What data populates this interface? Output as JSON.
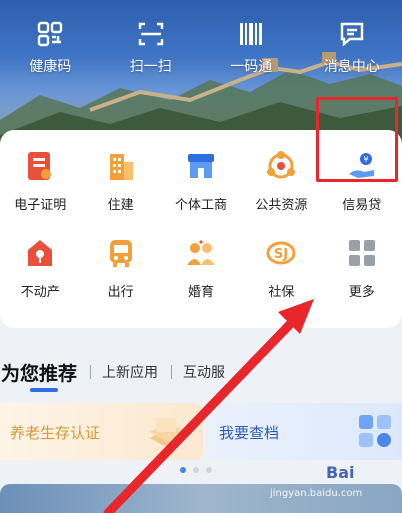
{
  "quick_actions": [
    {
      "label": "健康码",
      "icon": "health-code-icon"
    },
    {
      "label": "扫一扫",
      "icon": "scan-icon"
    },
    {
      "label": "一码通",
      "icon": "barcode-icon"
    },
    {
      "label": "消息中心",
      "icon": "message-icon"
    }
  ],
  "services_row1": [
    {
      "label": "电子证明",
      "icon": "certificate-icon"
    },
    {
      "label": "住建",
      "icon": "building-icon"
    },
    {
      "label": "个体工商",
      "icon": "shop-icon"
    },
    {
      "label": "公共资源",
      "icon": "resource-icon"
    },
    {
      "label": "信易贷",
      "icon": "loan-icon"
    }
  ],
  "services_row2": [
    {
      "label": "不动产",
      "icon": "house-key-icon"
    },
    {
      "label": "出行",
      "icon": "bus-icon"
    },
    {
      "label": "婚育",
      "icon": "couple-icon"
    },
    {
      "label": "社保",
      "icon": "social-security-icon"
    },
    {
      "label": "更多",
      "icon": "more-grid-icon"
    }
  ],
  "tabs": {
    "active": "为您推荐",
    "items": [
      "上新应用",
      "互动服"
    ]
  },
  "recommend": {
    "left_label": "养老生存认证",
    "right_label": "我要查档"
  },
  "watermark": {
    "text": "jingyan.baidu.com",
    "logo": "Bai"
  },
  "colors": {
    "accent": "#2f6ee0",
    "icon_orange": "#f2a13a",
    "icon_red": "#e8503a",
    "highlight": "#e8262b"
  }
}
